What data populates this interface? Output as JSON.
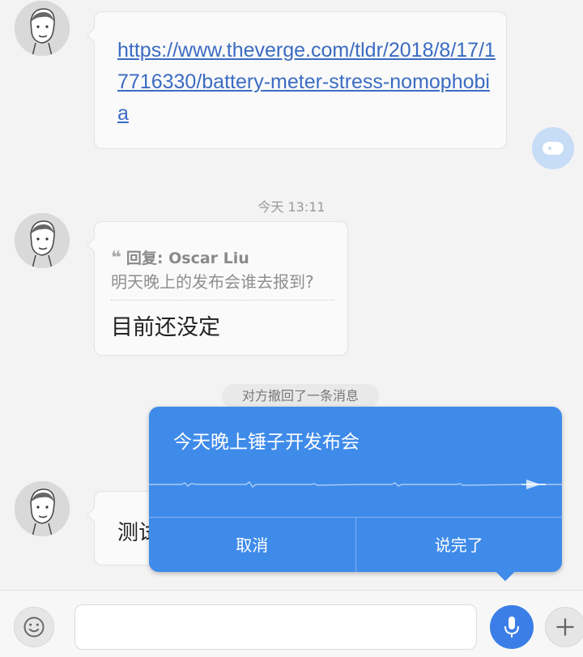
{
  "messages": {
    "link_message": {
      "text": "https://www.theverge.com/tldr/2018/8/17/17716330/battery-meter-stress-nomophobia"
    },
    "timestamp": "今天 13:11",
    "reply_message": {
      "quote_header": "回复: Oscar Liu",
      "quote_text": "明天晚上的发布会谁去报到?",
      "text": "目前还没定"
    },
    "recall_notice": "对方撤回了一条消息",
    "partial_message": {
      "text": "测试"
    }
  },
  "voice_input": {
    "recognized_text": "今天晚上锤子开发布会",
    "cancel_label": "取消",
    "done_label": "说完了"
  },
  "input_bar": {
    "placeholder": ""
  },
  "colors": {
    "accent": "#3f8bea",
    "link": "#3b6cc2"
  },
  "icons": [
    "avatar",
    "side-action-icon",
    "emoji-icon",
    "mic-icon",
    "plus-icon",
    "quote-icon"
  ]
}
